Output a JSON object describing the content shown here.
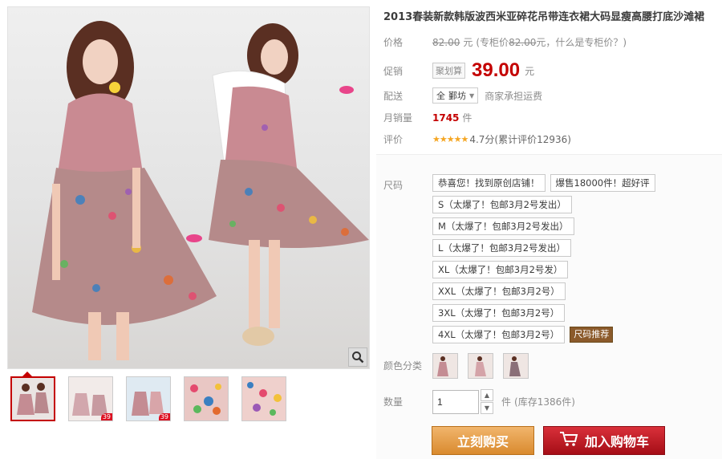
{
  "product": {
    "title": "2013春装新款韩版波西米亚碎花吊带连衣裙大码显瘦高腰打底沙滩裙"
  },
  "price": {
    "label": "价格",
    "original": "82.00",
    "unit": "元",
    "note_prefix": "(专柜价",
    "note_price": "82.00",
    "note_suffix": "元，什么是专柜价？)"
  },
  "promo": {
    "label": "促销",
    "tag": "聚划算",
    "price": "39.00",
    "unit": "元"
  },
  "shipping": {
    "label": "配送",
    "location_prefix": "全",
    "location": "鄞坊",
    "note": "商家承担运费"
  },
  "sales": {
    "label": "月销量",
    "count": "1745",
    "unit": "件"
  },
  "rating": {
    "label": "评价",
    "stars": "★★★★★",
    "score": "4.7分",
    "count_text": "(累计评价12936)"
  },
  "sku": {
    "size_label": "尺码",
    "size_options": [
      "恭喜您！找到原创店铺！",
      "爆售18000件！超好评",
      "S（太爆了！包邮3月2号发出）",
      "M（太爆了！包邮3月2号发出）",
      "L（太爆了！包邮3月2号发出）",
      "XL（太爆了！包邮3月2号发）",
      "XXL（太爆了！包邮3月2号）",
      "3XL（太爆了！包邮3月2号）",
      "4XL（太爆了！包邮3月2号）"
    ],
    "size_recommend": "尺码推荐",
    "color_label": "颜色分类",
    "qty_label": "数量",
    "qty_value": "1",
    "qty_unit": "件",
    "stock": "(库存1386件)"
  },
  "actions": {
    "buy_now": "立刻购买",
    "add_cart": "加入购物车"
  },
  "thumbs": {
    "badge": "39"
  },
  "colors": {
    "accent": "#c40000",
    "buy_button": "#d98a2e",
    "cart_button": "#c0141e",
    "star": "#f5a623"
  }
}
